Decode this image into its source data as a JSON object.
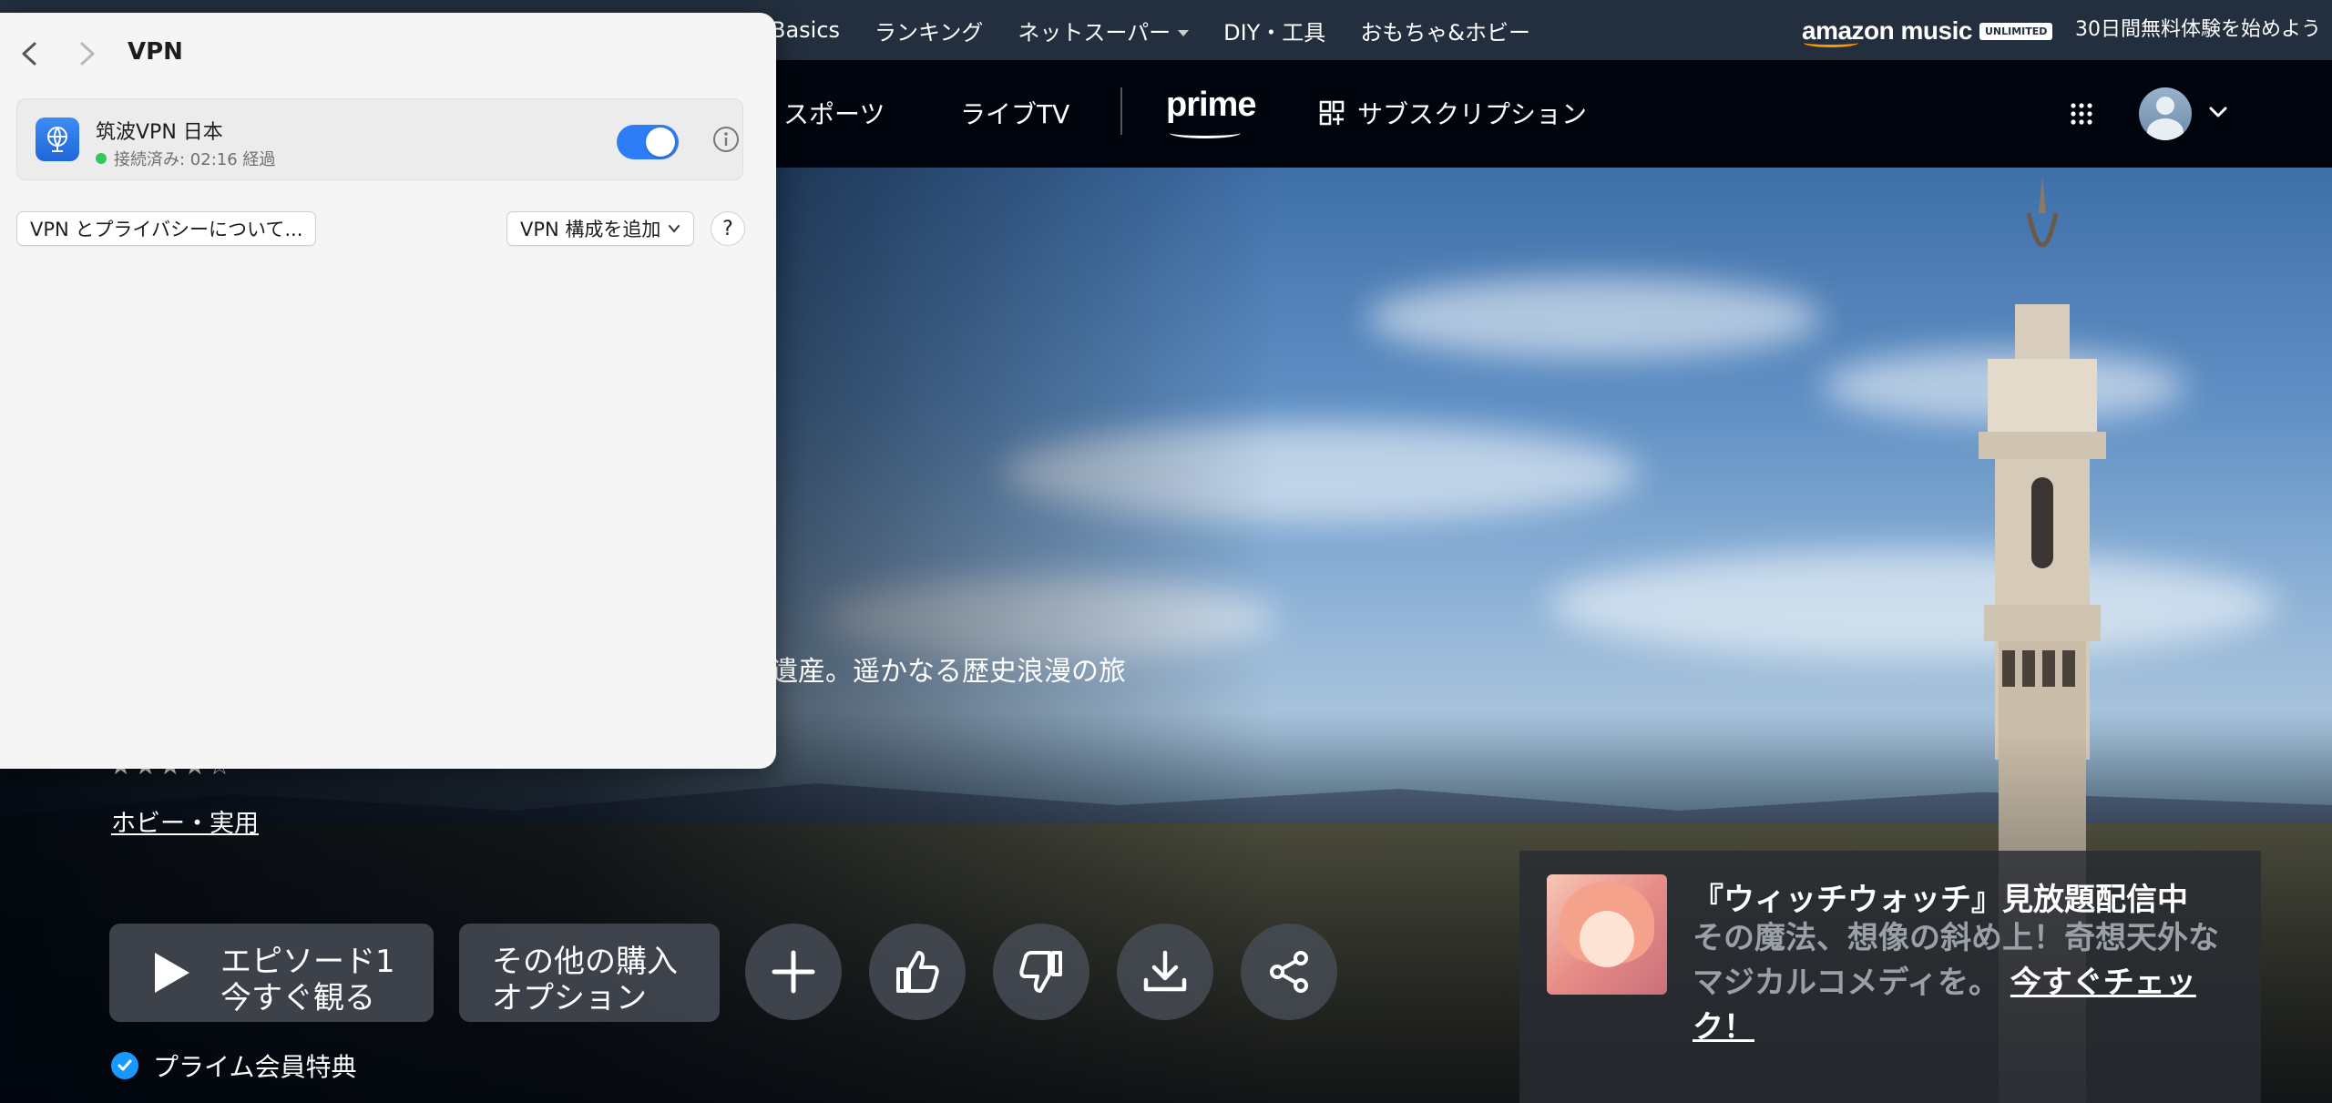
{
  "topnav": {
    "links": [
      "Basics",
      "ランキング",
      "ネットスーパー",
      "DIY・工具",
      "おもちゃ&ホビー"
    ],
    "music_logo": "amazon music",
    "music_badge": "UNLIMITED",
    "trial_text": "30日間無料体験を始めよう"
  },
  "primebar": {
    "sports": "スポーツ",
    "live_tv": "ライブTV",
    "prime_logo": "prime",
    "subscriptions": "サブスクリプション"
  },
  "hero": {
    "description": "遺産。遥かなる歴史浪漫の旅",
    "stars": "★★★★☆",
    "genre": "ホビー・実用",
    "play_line1": "エピソード1",
    "play_line2": "今すぐ観る",
    "buy_line1": "その他の購入",
    "buy_line2": "オプション",
    "prime_benefit": "プライム会員特典"
  },
  "promo": {
    "title": "『ウィッチウォッチ』見放題配信中",
    "body": "その魔法、想像の斜め上！奇想天外なマジカルコメディを。",
    "cta": "今すぐチェック！"
  },
  "vpn": {
    "title": "VPN",
    "connection_name": "筑波VPN 日本",
    "status": "接続済み: 02:16 経過",
    "privacy_button": "VPN とプライバシーについて...",
    "add_config_button": "VPN 構成を追加",
    "help_label": "?"
  },
  "colors": {
    "amazon_nav": "#232f3e",
    "prime_bar": "#00050d",
    "toggle_on": "#2f7df6",
    "connected_green": "#34c759",
    "check_blue": "#1a98ff"
  }
}
